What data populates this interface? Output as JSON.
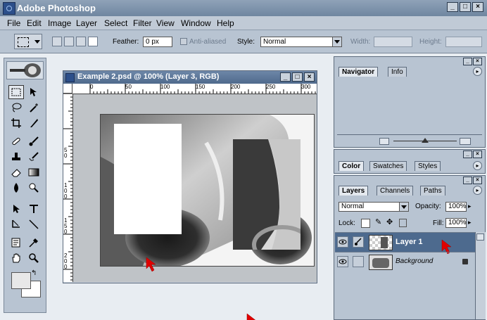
{
  "app": {
    "title": "Adobe Photoshop"
  },
  "colors": {
    "titlebar": "#7a8fa8",
    "chrome": "#b8c4d2",
    "doc_title": "#5a7396",
    "layer_selected": "#4d6a8e",
    "red_arrow": "#e00000"
  },
  "window_controls": [
    "_",
    "□",
    "×"
  ],
  "menu": [
    "File",
    "Edit",
    "Image",
    "Layer",
    "Select",
    "Filter",
    "View",
    "Window",
    "Help"
  ],
  "options": {
    "feather_label": "Feather:",
    "feather_value": "0 px",
    "antialiased_label": "Anti-aliased",
    "style_label": "Style:",
    "style_value": "Normal",
    "width_label": "Width:",
    "height_label": "Height:"
  },
  "document": {
    "title": "Example 2.psd @ 100% (Layer 3, RGB)",
    "ruler_top": [
      "0",
      "50",
      "100",
      "150",
      "200",
      "250",
      "300"
    ],
    "ruler_left": [
      "5",
      "0",
      "1",
      "0",
      "0",
      "1",
      "5",
      "0",
      "2",
      "0",
      "0"
    ]
  },
  "navigator_panel": {
    "tabs": [
      "Navigator",
      "Info"
    ]
  },
  "color_panel": {
    "tabs": [
      "Color",
      "Swatches",
      "Styles"
    ]
  },
  "layers_panel": {
    "tabs": [
      "Layers",
      "Channels",
      "Paths"
    ],
    "blend_mode": "Normal",
    "opacity_label": "Opacity:",
    "opacity_value": "100%",
    "lock_label": "Lock:",
    "fill_label": "Fill:",
    "fill_value": "100%",
    "layers": [
      {
        "name": "Layer 1",
        "selected": true
      },
      {
        "name": "Background",
        "selected": false,
        "locked": true
      }
    ]
  },
  "tools": [
    "marquee",
    "move",
    "lasso",
    "magic-wand",
    "crop",
    "slice",
    "healing",
    "brush",
    "stamp",
    "history-brush",
    "eraser",
    "gradient",
    "blur",
    "dodge",
    "path-select",
    "type",
    "pen",
    "shape",
    "notes",
    "eyedropper",
    "hand",
    "zoom"
  ]
}
